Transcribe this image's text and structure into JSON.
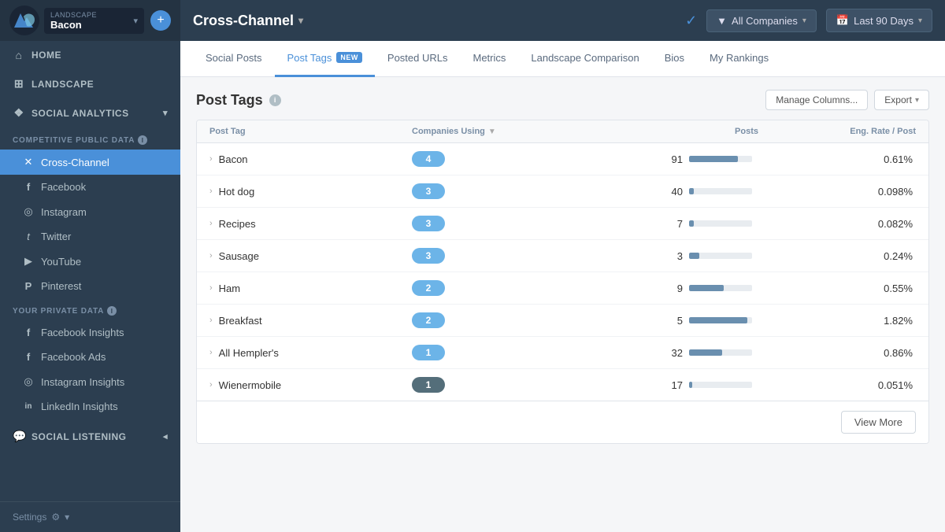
{
  "sidebar": {
    "logo_alt": "RivalIQ logo",
    "landscape_label": "LANDSCAPE",
    "landscape_name": "Bacon",
    "add_button_label": "+",
    "nav_items": [
      {
        "id": "home",
        "label": "HOME",
        "icon": "⌂"
      },
      {
        "id": "landscape",
        "label": "LANDSCAPE",
        "icon": "⊞"
      }
    ],
    "social_analytics_label": "SOCIAL ANALYTICS",
    "competitive_section_label": "COMPETITIVE PUBLIC DATA",
    "competitive_items": [
      {
        "id": "cross-channel",
        "label": "Cross-Channel",
        "icon": "✕",
        "active": true
      },
      {
        "id": "facebook",
        "label": "Facebook",
        "icon": "f"
      },
      {
        "id": "instagram",
        "label": "Instagram",
        "icon": "◎"
      },
      {
        "id": "twitter",
        "label": "Twitter",
        "icon": "t"
      },
      {
        "id": "youtube",
        "label": "YouTube",
        "icon": "▶"
      },
      {
        "id": "pinterest",
        "label": "Pinterest",
        "icon": "P"
      }
    ],
    "private_section_label": "YOUR PRIVATE DATA",
    "private_items": [
      {
        "id": "facebook-insights",
        "label": "Facebook Insights",
        "icon": "f"
      },
      {
        "id": "facebook-ads",
        "label": "Facebook Ads",
        "icon": "f"
      },
      {
        "id": "instagram-insights",
        "label": "Instagram Insights",
        "icon": "◎"
      },
      {
        "id": "linkedin-insights",
        "label": "LinkedIn Insights",
        "icon": "in"
      }
    ],
    "social_listening_label": "SOCIAL LISTENING",
    "settings_label": "Settings"
  },
  "topbar": {
    "title": "Cross-Channel",
    "checkmark": "✓",
    "companies_btn": "All Companies",
    "date_btn": "Last 90 Days",
    "filter_icon": "▼",
    "calendar_icon": "📅"
  },
  "tabs": [
    {
      "id": "social-posts",
      "label": "Social Posts",
      "active": false
    },
    {
      "id": "post-tags",
      "label": "Post Tags",
      "active": true,
      "badge": "NEW"
    },
    {
      "id": "posted-urls",
      "label": "Posted URLs",
      "active": false
    },
    {
      "id": "metrics",
      "label": "Metrics",
      "active": false
    },
    {
      "id": "landscape-comparison",
      "label": "Landscape Comparison",
      "active": false
    },
    {
      "id": "bios",
      "label": "Bios",
      "active": false
    },
    {
      "id": "my-rankings",
      "label": "My Rankings",
      "active": false
    }
  ],
  "post_tags": {
    "title": "Post Tags",
    "manage_columns_btn": "Manage Columns...",
    "export_btn": "Export",
    "columns": [
      {
        "id": "post-tag",
        "label": "Post Tag",
        "sortable": false
      },
      {
        "id": "companies-using",
        "label": "Companies Using",
        "sortable": true
      },
      {
        "id": "posts",
        "label": "Posts",
        "sortable": false
      },
      {
        "id": "eng-rate",
        "label": "Eng. Rate / Post",
        "sortable": false
      }
    ],
    "rows": [
      {
        "tag": "Bacon",
        "companies": 4,
        "badge_color": "blue",
        "posts": 91,
        "bar_pct": 78,
        "eng_rate": "0.61%"
      },
      {
        "tag": "Hot dog",
        "companies": 3,
        "badge_color": "blue",
        "posts": 40,
        "bar_pct": 8,
        "eng_rate": "0.098%"
      },
      {
        "tag": "Recipes",
        "companies": 3,
        "badge_color": "blue",
        "posts": 7,
        "bar_pct": 7,
        "eng_rate": "0.082%"
      },
      {
        "tag": "Sausage",
        "companies": 3,
        "badge_color": "blue",
        "posts": 3,
        "bar_pct": 16,
        "eng_rate": "0.24%"
      },
      {
        "tag": "Ham",
        "companies": 2,
        "badge_color": "blue",
        "posts": 9,
        "bar_pct": 55,
        "eng_rate": "0.55%"
      },
      {
        "tag": "Breakfast",
        "companies": 2,
        "badge_color": "blue",
        "posts": 5,
        "bar_pct": 92,
        "eng_rate": "1.82%"
      },
      {
        "tag": "All Hempler's",
        "companies": 1,
        "badge_color": "blue",
        "posts": 32,
        "bar_pct": 52,
        "eng_rate": "0.86%"
      },
      {
        "tag": "Wienermobile",
        "companies": 1,
        "badge_color": "dark",
        "posts": 17,
        "bar_pct": 5,
        "eng_rate": "0.051%"
      }
    ],
    "view_more_btn": "View More"
  }
}
